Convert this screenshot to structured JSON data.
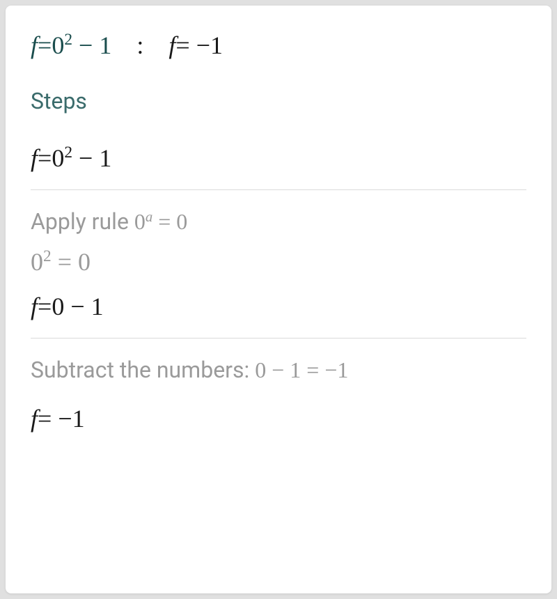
{
  "header": {
    "equation_lhs_f": "f",
    "equation_lhs_eq": "=",
    "equation_lhs_base": "0",
    "equation_lhs_exp": "2",
    "equation_lhs_minus": " − 1",
    "colon": ":",
    "result_f": "f",
    "result_eq": "= ",
    "result_val": "−1"
  },
  "steps_label": "Steps",
  "step1": {
    "f": "f",
    "eq": "=",
    "base": "0",
    "exp": "2",
    "rest": " − 1"
  },
  "rule": {
    "prefix": "Apply rule ",
    "base": "0",
    "exp": "a",
    "eq": " = 0"
  },
  "rule_applied": {
    "base": "0",
    "exp": "2",
    "eq": " = 0"
  },
  "step2": {
    "f": "f",
    "eq": "=",
    "rest": "0 − 1"
  },
  "subtract": {
    "prefix": "Subtract the numbers: ",
    "expr": "0 − 1 = −1"
  },
  "final": {
    "f": "f",
    "eq": "= ",
    "val": "−1"
  }
}
